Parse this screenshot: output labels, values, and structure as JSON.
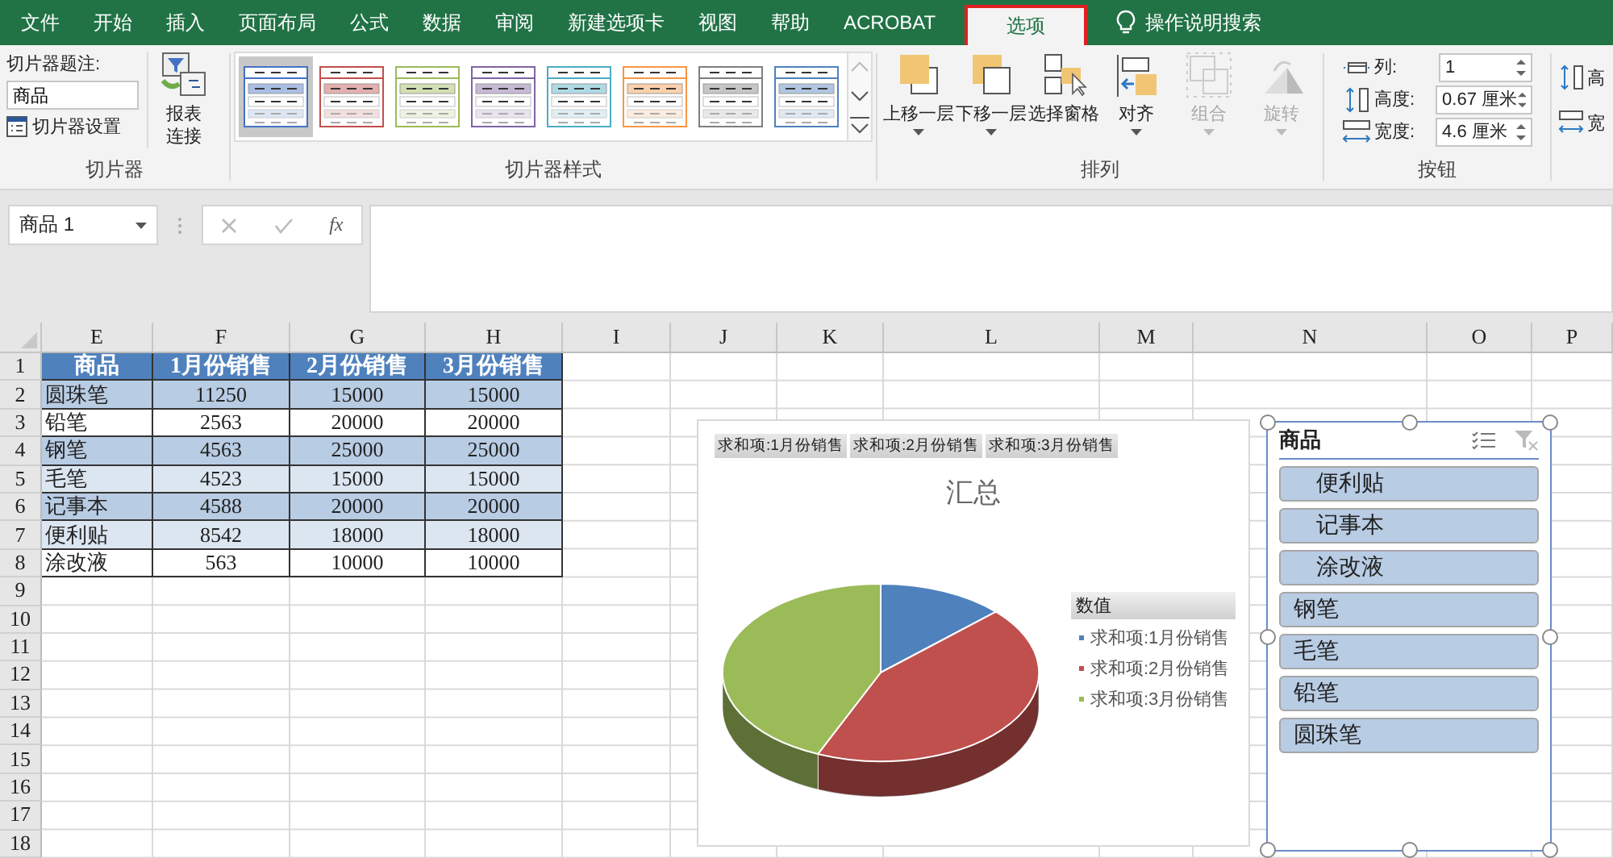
{
  "menu_tabs": [
    {
      "label": "文件",
      "selected": false
    },
    {
      "label": "开始",
      "selected": false
    },
    {
      "label": "插入",
      "selected": false
    },
    {
      "label": "页面布局",
      "selected": false
    },
    {
      "label": "公式",
      "selected": false
    },
    {
      "label": "数据",
      "selected": false
    },
    {
      "label": "审阅",
      "selected": false
    },
    {
      "label": "新建选项卡",
      "selected": false
    },
    {
      "label": "视图",
      "selected": false
    },
    {
      "label": "帮助",
      "selected": false
    },
    {
      "label": "ACROBAT",
      "selected": false
    },
    {
      "label": "选项",
      "selected": true
    }
  ],
  "tell_me": "操作说明搜索",
  "slicer_group": {
    "caption_label": "切片器题注:",
    "caption_value": "商品",
    "settings": "切片器设置",
    "report_connections": "报表连接",
    "label": "切片器"
  },
  "styles_group": {
    "label": "切片器样式",
    "styles": [
      {
        "color": "#4472c4",
        "selected": true
      },
      {
        "color": "#c0504d",
        "selected": false
      },
      {
        "color": "#9bbb59",
        "selected": false
      },
      {
        "color": "#8064a2",
        "selected": false
      },
      {
        "color": "#4bacc6",
        "selected": false
      },
      {
        "color": "#f79646",
        "selected": false
      },
      {
        "color": "#7f7f7f",
        "selected": false
      },
      {
        "color": "#4f81bd",
        "selected": false
      }
    ]
  },
  "arrange_group": {
    "label": "排列",
    "buttons": [
      {
        "label": "上移一层",
        "kind": "bring-forward",
        "disabled": false,
        "dropdown": true
      },
      {
        "label": "下移一层",
        "kind": "send-backward",
        "disabled": false,
        "dropdown": true
      },
      {
        "label": "选择窗格",
        "kind": "selection-pane",
        "disabled": false,
        "dropdown": false
      },
      {
        "label": "对齐",
        "kind": "align",
        "disabled": false,
        "dropdown": true
      },
      {
        "label": "组合",
        "kind": "group",
        "disabled": true,
        "dropdown": true
      },
      {
        "label": "旋转",
        "kind": "rotate",
        "disabled": true,
        "dropdown": true
      }
    ]
  },
  "buttons_group": {
    "label": "按钮",
    "fields": [
      {
        "kind": "columns",
        "label": "列:",
        "value": "1"
      },
      {
        "kind": "height",
        "label": "高度:",
        "value": "0.67 厘米"
      },
      {
        "kind": "width",
        "label": "宽度:",
        "value": "4.6 厘米"
      }
    ]
  },
  "size_group": {
    "labels": [
      "高",
      "宽"
    ]
  },
  "name_box": "商品 1",
  "function_button": "fx",
  "sheet": {
    "columns": [
      "E",
      "F",
      "G",
      "H",
      "I",
      "J",
      "K",
      "L",
      "M",
      "N",
      "O",
      "P"
    ],
    "rows": [
      "1",
      "2",
      "3",
      "4",
      "5",
      "6",
      "7",
      "8",
      "9",
      "10",
      "11",
      "12",
      "13",
      "14",
      "15",
      "16",
      "17",
      "18"
    ],
    "header": [
      "商品",
      "1月份销售",
      "2月份销售",
      "3月份销售"
    ],
    "table": [
      {
        "color": "#b8cce4",
        "cells": [
          "圆珠笔",
          "11250",
          "15000",
          "15000"
        ]
      },
      {
        "color": "#ffffff",
        "cells": [
          "铅笔",
          "2563",
          "20000",
          "20000"
        ]
      },
      {
        "color": "#b8cce4",
        "cells": [
          "钢笔",
          "4563",
          "25000",
          "25000"
        ]
      },
      {
        "color": "#dce6f1",
        "cells": [
          "毛笔",
          "4523",
          "15000",
          "15000"
        ]
      },
      {
        "color": "#b8cce4",
        "cells": [
          "记事本",
          "4588",
          "20000",
          "20000"
        ]
      },
      {
        "color": "#dce6f1",
        "cells": [
          "便利贴",
          "8542",
          "18000",
          "18000"
        ]
      },
      {
        "color": "#ffffff",
        "cells": [
          "涂改液",
          "563",
          "10000",
          "10000"
        ]
      }
    ]
  },
  "chart": {
    "field_buttons": [
      "求和项:1月份销售",
      "求和项:2月份销售",
      "求和项:3月份销售"
    ],
    "title": "汇总",
    "legend_title": "数值",
    "legend": [
      {
        "label": "求和项:1月份销售",
        "color": "#4f81bd"
      },
      {
        "label": "求和项:2月份销售",
        "color": "#c0504d"
      },
      {
        "label": "求和项:3月份销售",
        "color": "#9bbb59"
      }
    ]
  },
  "slicer": {
    "title": "商品",
    "selected": true,
    "items": [
      {
        "label": "便利贴",
        "indented": true,
        "selected": true
      },
      {
        "label": "记事本",
        "indented": true,
        "selected": true
      },
      {
        "label": "涂改液",
        "indented": true,
        "selected": true
      },
      {
        "label": "钢笔",
        "indented": false,
        "selected": true
      },
      {
        "label": "毛笔",
        "indented": false,
        "selected": true
      },
      {
        "label": "铅笔",
        "indented": false,
        "selected": true
      },
      {
        "label": "圆珠笔",
        "indented": false,
        "selected": true
      }
    ]
  }
}
